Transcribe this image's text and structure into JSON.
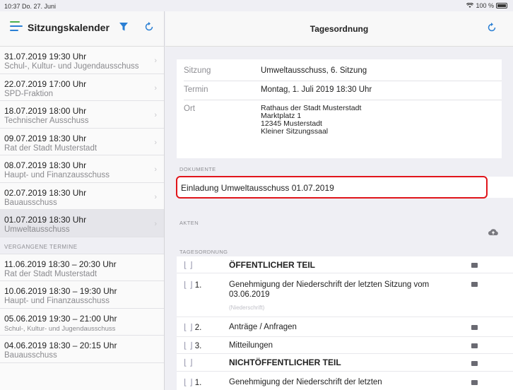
{
  "status": {
    "time": "10:37  Do. 27. Juni",
    "battery": "100 %"
  },
  "sidebar": {
    "title": "Sitzungskalender",
    "upcoming": [
      {
        "date": "31.07.2019 19:30 Uhr",
        "name": "Schul-, Kultur- und Jugendausschuss"
      },
      {
        "date": "22.07.2019 17:00 Uhr",
        "name": "SPD-Fraktion"
      },
      {
        "date": "18.07.2019 18:00 Uhr",
        "name": "Technischer Ausschuss"
      },
      {
        "date": "09.07.2019 18:30 Uhr",
        "name": "Rat der Stadt Musterstadt"
      },
      {
        "date": "08.07.2019 18:30 Uhr",
        "name": "Haupt- und Finanzausschuss"
      },
      {
        "date": "02.07.2019 18:30 Uhr",
        "name": "Bauausschuss"
      },
      {
        "date": "01.07.2019 18:30 Uhr",
        "name": "Umweltausschuss"
      }
    ],
    "past_label": "Vergangene Termine",
    "past": [
      {
        "date": "11.06.2019 18:30 – 20:30 Uhr",
        "name": "Rat der Stadt Musterstadt"
      },
      {
        "date": "10.06.2019 18:30 – 19:30 Uhr",
        "name": "Haupt- und Finanzausschuss"
      },
      {
        "date": "05.06.2019 19:30 – 21:00 Uhr",
        "name": "Schul-, Kultur- und Jugendausschuss"
      },
      {
        "date": "04.06.2019 18:30 – 20:15 Uhr",
        "name": "Bauausschuss"
      }
    ]
  },
  "main": {
    "title": "Tagesordnung",
    "info": {
      "sitzung_label": "Sitzung",
      "sitzung_value": "Umweltausschuss, 6. Sitzung",
      "termin_label": "Termin",
      "termin_value": "Montag, 1. Juli 2019 18:30 Uhr",
      "ort_label": "Ort",
      "ort_line1": "Rathaus der Stadt Musterstadt",
      "ort_line2": "Marktplatz 1",
      "ort_line3": "12345 Musterstadt",
      "ort_line4": "Kleiner Sitzungssaal"
    },
    "documents_label": "Dokumente",
    "document": "Einladung Umweltausschuss 01.07.2019",
    "akten_label": "Akten",
    "agenda_label": "Tagesordnung",
    "agenda": [
      {
        "num": "",
        "title": "ÖFFENTLICHER TEIL",
        "bold": true
      },
      {
        "num": "1.",
        "title": "Genehmigung der Niederschrift der letzten Sitzung vom 03.06.2019",
        "sub": "(Niederschrift)"
      },
      {
        "num": "2.",
        "title": "Anträge / Anfragen"
      },
      {
        "num": "3.",
        "title": "Mitteilungen"
      },
      {
        "num": "",
        "title": "NICHTÖFFENTLICHER TEIL",
        "bold": true
      },
      {
        "num": "1.",
        "title": "Genehmigung der Niederschrift der letzten"
      }
    ]
  }
}
